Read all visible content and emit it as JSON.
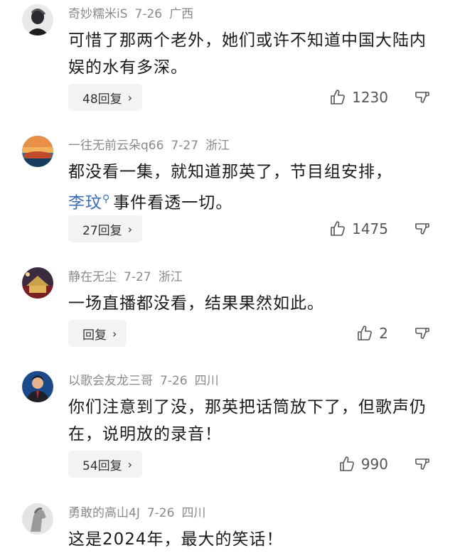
{
  "comments": [
    {
      "username": "奇妙糯米iS",
      "date": "7-26",
      "location": "广西",
      "avatar_icon": "dark-figure-avatar",
      "text_parts": [
        "可惜了那两个老外，她们或许不知道中国大陆内娱的水有多深。"
      ],
      "reply_label": "48回复",
      "likes": "1230"
    },
    {
      "username": "一往无前云朵q66",
      "date": "7-27",
      "location": "浙江",
      "avatar_icon": "sunset-avatar",
      "text_before": "都没看一集，就知道那英了，节目组安排，",
      "link_text": "李玟",
      "text_after": "事件看透一切。",
      "reply_label": "27回复",
      "likes": "1475"
    },
    {
      "username": "静在无尘",
      "date": "7-27",
      "location": "浙江",
      "avatar_icon": "palace-avatar",
      "text_parts": [
        "一场直播都没看，结果果然如此。"
      ],
      "reply_label": "回复",
      "likes": "2"
    },
    {
      "username": "以歌会友龙三哥",
      "date": "7-26",
      "location": "四川",
      "avatar_icon": "man-suit-avatar",
      "text_parts": [
        "你们注意到了没，那英把话筒放下了，但歌声仍在，说明放的录音！"
      ],
      "reply_label": "54回复",
      "likes": "990"
    },
    {
      "username": "勇敢的高山4J",
      "date": "7-26",
      "location": "四川",
      "avatar_icon": "horse-avatar",
      "text_parts": [
        "这是2024年，最大的笑话！"
      ]
    }
  ]
}
